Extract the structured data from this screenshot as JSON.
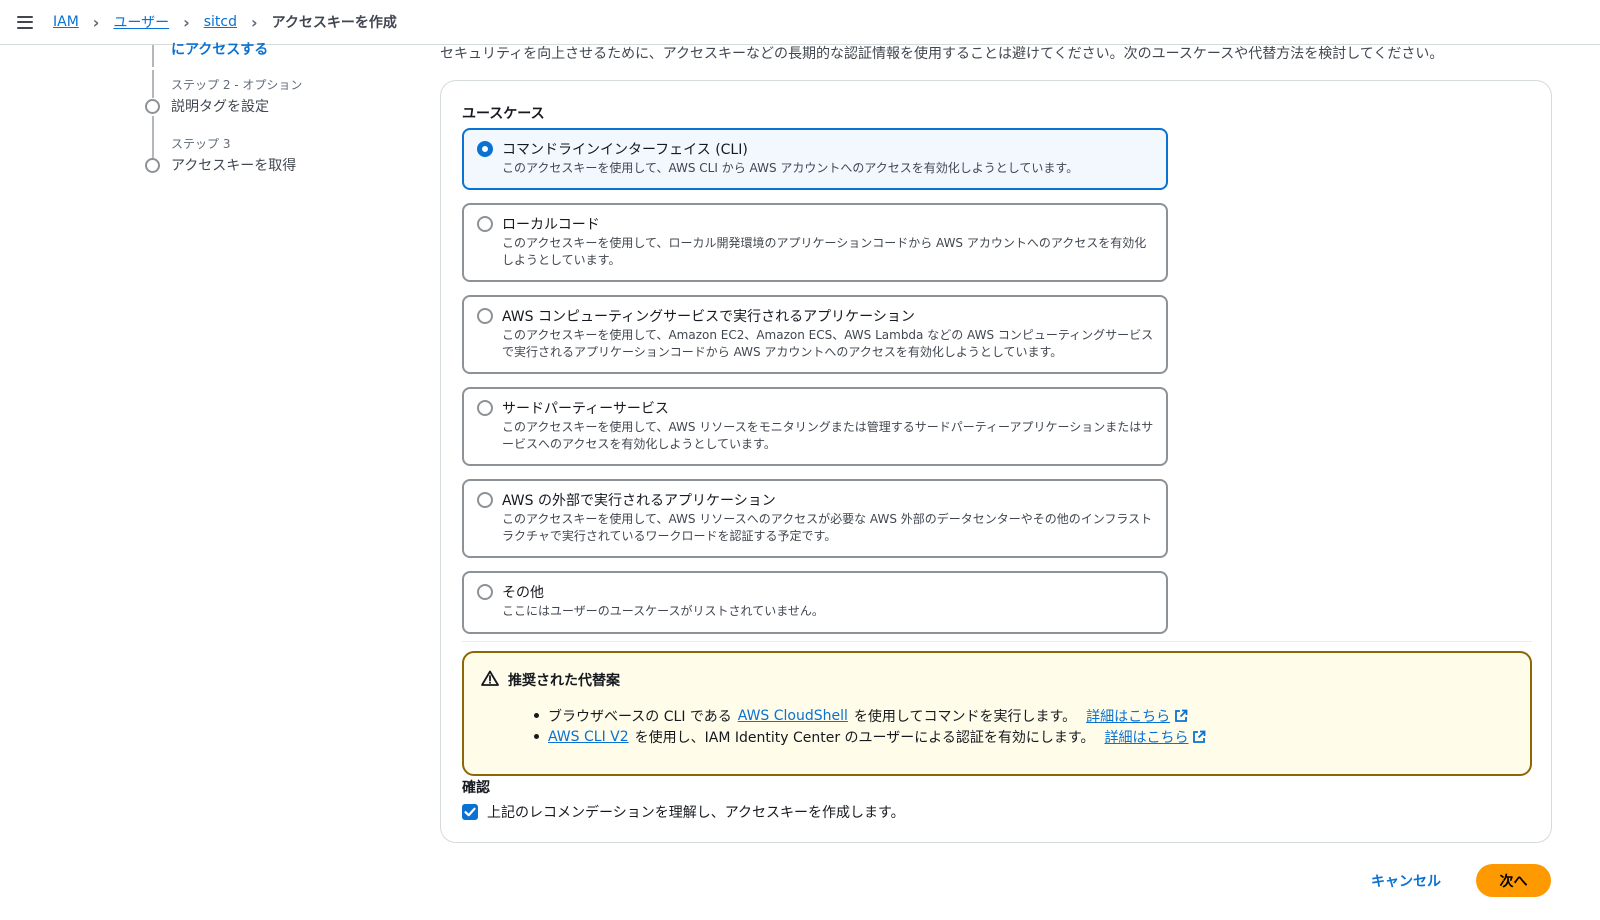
{
  "breadcrumb": {
    "items": [
      "IAM",
      "ユーザー",
      "sitcd"
    ],
    "current": "アクセスキーを作成"
  },
  "steps": {
    "active_partial": "にアクセスする",
    "step2": {
      "sub": "ステップ 2 - オプション",
      "title": "説明タグを設定"
    },
    "step3": {
      "sub": "ステップ 3",
      "title": "アクセスキーを取得"
    }
  },
  "intro": "セキュリティを向上させるために、アクセスキーなどの長期的な認証情報を使用することは避けてください。次のユースケースや代替方法を検討してください。",
  "use_cases": {
    "heading": "ユースケース",
    "options": [
      {
        "label": "コマンドラインインターフェイス (CLI)",
        "desc": "このアクセスキーを使用して、AWS CLI から AWS アカウントへのアクセスを有効化しようとしています。",
        "selected": true
      },
      {
        "label": "ローカルコード",
        "desc": "このアクセスキーを使用して、ローカル開発環境のアプリケーションコードから AWS アカウントへのアクセスを有効化しようとしています。",
        "selected": false
      },
      {
        "label": "AWS コンピューティングサービスで実行されるアプリケーション",
        "desc": "このアクセスキーを使用して、Amazon EC2、Amazon ECS、AWS Lambda などの AWS コンピューティングサービスで実行されるアプリケーションコードから AWS アカウントへのアクセスを有効化しようとしています。",
        "selected": false
      },
      {
        "label": "サードパーティーサービス",
        "desc": "このアクセスキーを使用して、AWS リソースをモニタリングまたは管理するサードパーティーアプリケーションまたはサービスへのアクセスを有効化しようとしています。",
        "selected": false
      },
      {
        "label": "AWS の外部で実行されるアプリケーション",
        "desc": "このアクセスキーを使用して、AWS リソースへのアクセスが必要な AWS 外部のデータセンターやその他のインフラストラクチャで実行されているワークロードを認証する予定です。",
        "selected": false
      },
      {
        "label": "その他",
        "desc": "ここにはユーザーのユースケースがリストされていません。",
        "selected": false
      }
    ]
  },
  "alternatives": {
    "title": "推奨された代替案",
    "bullet1": {
      "pre": "ブラウザベースの CLI である",
      "link": "AWS CloudShell",
      "post": "を使用してコマンドを実行します。",
      "more": "詳細はこちら"
    },
    "bullet2": {
      "link": "AWS CLI V2",
      "post": "を使用し、IAM Identity Center のユーザーによる認証を有効にします。",
      "more": "詳細はこちら"
    }
  },
  "confirmation": {
    "heading": "確認",
    "label": "上記のレコメンデーションを理解し、アクセスキーを作成します。",
    "checked": true
  },
  "buttons": {
    "cancel": "キャンセル",
    "next": "次へ"
  },
  "colors": {
    "accent": "#0972d3",
    "primary_button": "#ff9900",
    "warning_border": "#8d6605",
    "warning_bg": "#fffce9"
  }
}
